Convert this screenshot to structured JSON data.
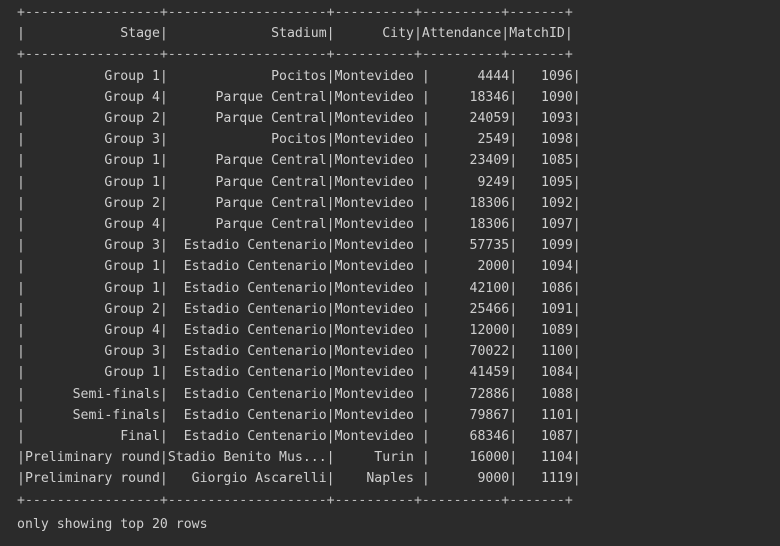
{
  "console": {
    "border_line": "+-----------------+--------------------+----------+----------+-------+",
    "header_line": "|            Stage|             Stadium|      City|Attendance|MatchID|",
    "rows": [
      "|          Group 1|             Pocitos|Montevideo |      4444|   1096|",
      "|          Group 4|      Parque Central|Montevideo |     18346|   1090|",
      "|          Group 2|      Parque Central|Montevideo |     24059|   1093|",
      "|          Group 3|             Pocitos|Montevideo |      2549|   1098|",
      "|          Group 1|      Parque Central|Montevideo |     23409|   1085|",
      "|          Group 1|      Parque Central|Montevideo |      9249|   1095|",
      "|          Group 2|      Parque Central|Montevideo |     18306|   1092|",
      "|          Group 4|      Parque Central|Montevideo |     18306|   1097|",
      "|          Group 3|  Estadio Centenario|Montevideo |     57735|   1099|",
      "|          Group 1|  Estadio Centenario|Montevideo |      2000|   1094|",
      "|          Group 1|  Estadio Centenario|Montevideo |     42100|   1086|",
      "|          Group 2|  Estadio Centenario|Montevideo |     25466|   1091|",
      "|          Group 4|  Estadio Centenario|Montevideo |     12000|   1089|",
      "|          Group 3|  Estadio Centenario|Montevideo |     70022|   1100|",
      "|          Group 1|  Estadio Centenario|Montevideo |     41459|   1084|",
      "|      Semi-finals|  Estadio Centenario|Montevideo |     72886|   1088|",
      "|      Semi-finals|  Estadio Centenario|Montevideo |     79867|   1101|",
      "|            Final|  Estadio Centenario|Montevideo |     68346|   1087|",
      "|Preliminary round|Stadio Benito Mus...|     Turin |     16000|   1104|",
      "|Preliminary round|   Giorgio Ascarelli|    Naples |      9000|   1119|"
    ],
    "footer": "only showing top 20 rows"
  }
}
